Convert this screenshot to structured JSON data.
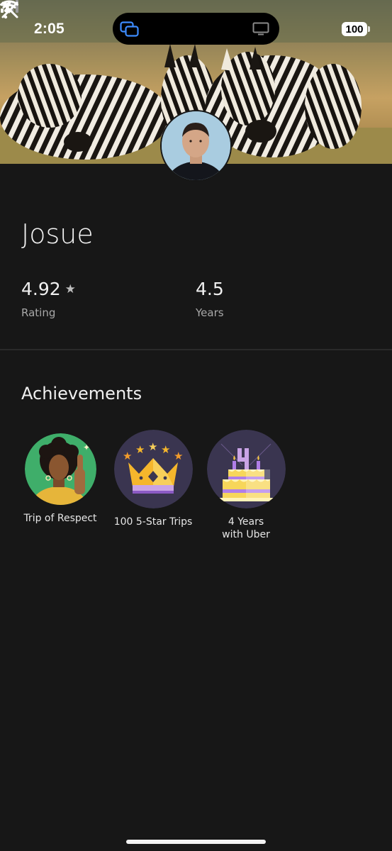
{
  "status_bar": {
    "time": "2:05",
    "battery": "100"
  },
  "profile": {
    "name": "Josue",
    "rating_value": "4.92",
    "rating_label": "Rating",
    "years_value": "4.5",
    "years_label": "Years"
  },
  "achievements": {
    "title": "Achievements",
    "items": [
      {
        "label": "Trip of Respect",
        "icon": "thumbs-up-person-icon"
      },
      {
        "label": "100 5-Star Trips",
        "icon": "crown-icon"
      },
      {
        "label": "4 Years\nwith Uber",
        "icon": "cake-icon"
      }
    ]
  },
  "colors": {
    "background": "#171717",
    "respect_badge_bg": "#3fae6a",
    "crown_badge_bg": "#3a3550",
    "cake_badge_bg": "#3a3550"
  }
}
